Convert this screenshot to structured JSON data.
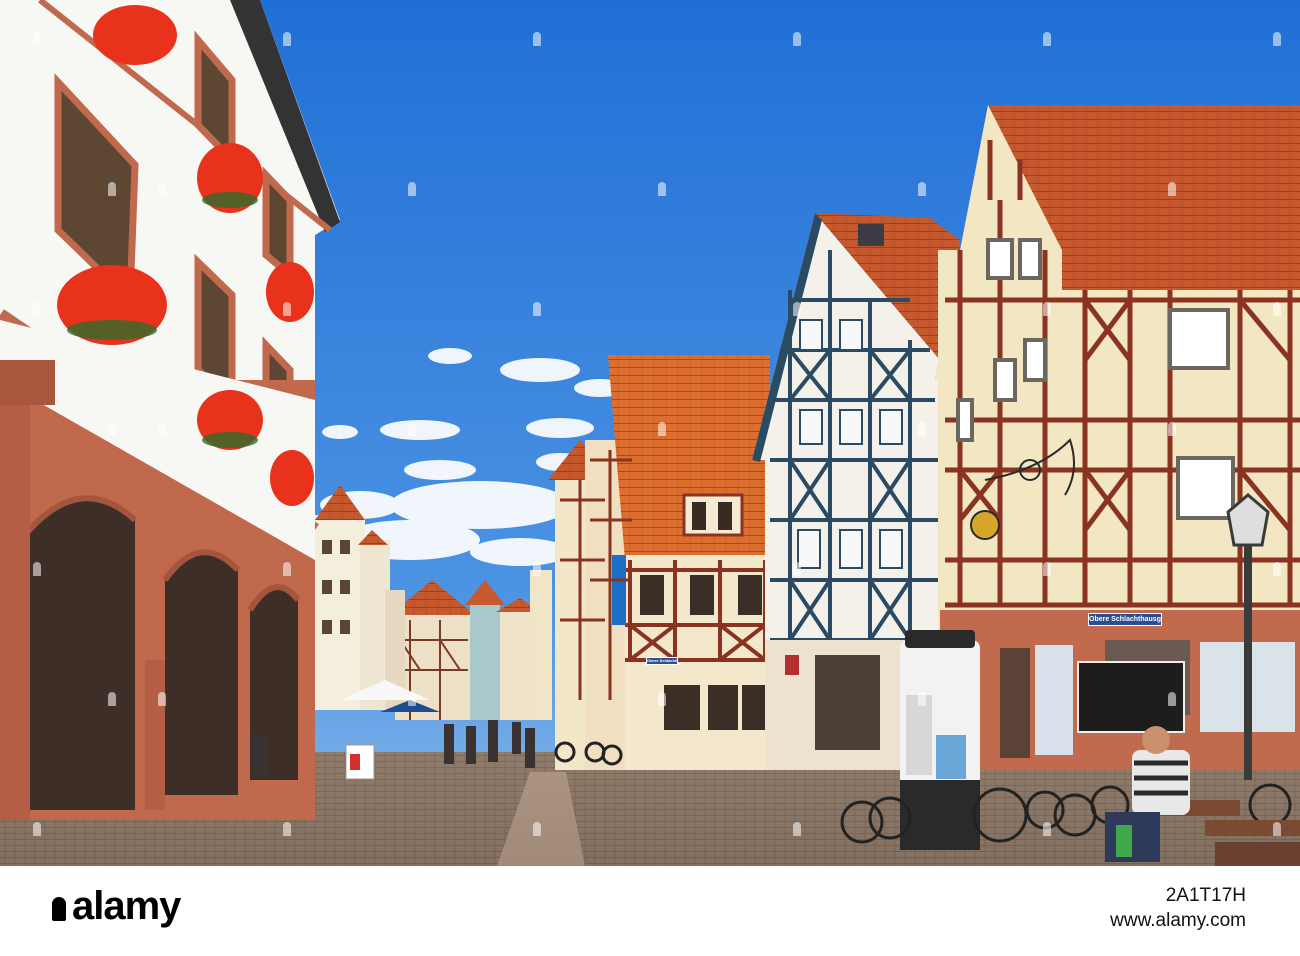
{
  "scene": {
    "kind": "photo",
    "subject": "street of half-timbered houses with cobblestone pavement",
    "colors": {
      "sky": "#2f7fdc",
      "sky_light": "#69a9ec",
      "roof": "#c9552c",
      "timber": "#8a3320",
      "timber_blue": "#2b4a63",
      "plaster": "#f3e7c9",
      "sandstone": "#c1694d",
      "cobble": "#8b7767",
      "geranium": "#e8321c"
    }
  },
  "signs": {
    "street_name": "Obere Schlachthausgasse",
    "small_sign": "Obere Schlachthausgasse"
  },
  "footer": {
    "logo_text": "alamy",
    "image_id": "2A1T17H",
    "site": "www.alamy.com"
  }
}
